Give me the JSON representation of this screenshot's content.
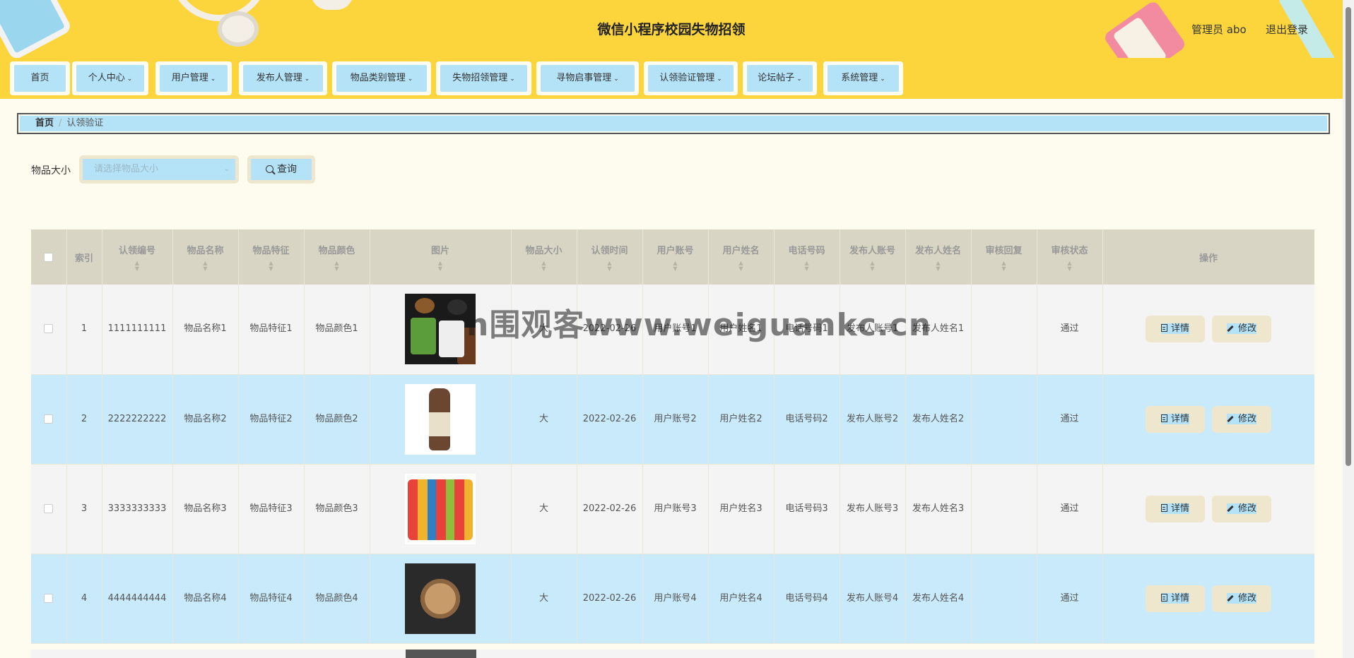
{
  "header": {
    "title": "微信小程序校园失物招领",
    "user_label": "管理员 abo",
    "logout_label": "退出登录"
  },
  "nav": {
    "items": [
      {
        "label": "首页",
        "has_dropdown": false
      },
      {
        "label": "个人中心",
        "has_dropdown": true
      },
      {
        "label": "用户管理",
        "has_dropdown": true
      },
      {
        "label": "发布人管理",
        "has_dropdown": true
      },
      {
        "label": "物品类别管理",
        "has_dropdown": true
      },
      {
        "label": "失物招领管理",
        "has_dropdown": true
      },
      {
        "label": "寻物启事管理",
        "has_dropdown": true
      },
      {
        "label": "认领验证管理",
        "has_dropdown": true
      },
      {
        "label": "论坛帖子",
        "has_dropdown": true
      },
      {
        "label": "系统管理",
        "has_dropdown": true
      }
    ],
    "dropdown_icon": "chevron-down-icon"
  },
  "breadcrumb": {
    "home": "首页",
    "separator": "/",
    "current": "认领验证"
  },
  "search": {
    "label": "物品大小",
    "placeholder": "请选择物品大小",
    "button_label": "查询"
  },
  "table": {
    "columns": [
      "索引",
      "认领编号",
      "物品名称",
      "物品特征",
      "物品颜色",
      "图片",
      "物品大小",
      "认领时间",
      "用户账号",
      "用户姓名",
      "电话号码",
      "发布人账号",
      "发布人姓名",
      "审核回复",
      "审核状态",
      "操作"
    ],
    "rows": [
      {
        "index": "1",
        "code": "1111111111",
        "name": "物品名称1",
        "feature": "物品特征1",
        "color": "物品颜色1",
        "image": "food",
        "size": "大",
        "time": "2022-02-26",
        "account": "用户账号1",
        "username": "用户姓名1",
        "phone": "电话号码1",
        "pub_account": "发布人账号1",
        "pub_name": "发布人姓名1",
        "reply": "",
        "status": "通过"
      },
      {
        "index": "2",
        "code": "2222222222",
        "name": "物品名称2",
        "feature": "物品特征2",
        "color": "物品颜色2",
        "image": "bottle",
        "size": "大",
        "time": "2022-02-26",
        "account": "用户账号2",
        "username": "用户姓名2",
        "phone": "电话号码2",
        "pub_account": "发布人账号2",
        "pub_name": "发布人姓名2",
        "reply": "",
        "status": "通过"
      },
      {
        "index": "3",
        "code": "3333333333",
        "name": "物品名称3",
        "feature": "物品特征3",
        "color": "物品颜色3",
        "image": "snack",
        "size": "大",
        "time": "2022-02-26",
        "account": "用户账号3",
        "username": "用户姓名3",
        "phone": "电话号码3",
        "pub_account": "发布人账号3",
        "pub_name": "发布人姓名3",
        "reply": "",
        "status": "通过"
      },
      {
        "index": "4",
        "code": "4444444444",
        "name": "物品名称4",
        "feature": "物品特征4",
        "color": "物品颜色4",
        "image": "watch",
        "size": "大",
        "time": "2022-02-26",
        "account": "用户账号4",
        "username": "用户姓名4",
        "phone": "电话号码4",
        "pub_account": "发布人账号4",
        "pub_name": "发布人姓名4",
        "reply": "",
        "status": "通过"
      }
    ],
    "actions": {
      "detail_label": "详情",
      "edit_label": "修改"
    }
  },
  "watermark": "n围观客www.weiguankc.cn",
  "colors": {
    "header_bg": "#fcd53d",
    "page_bg": "#fefbef",
    "accent": "#b4e2f7",
    "row_alt": "#c9eafb",
    "table_head": "#d9d5c4"
  }
}
